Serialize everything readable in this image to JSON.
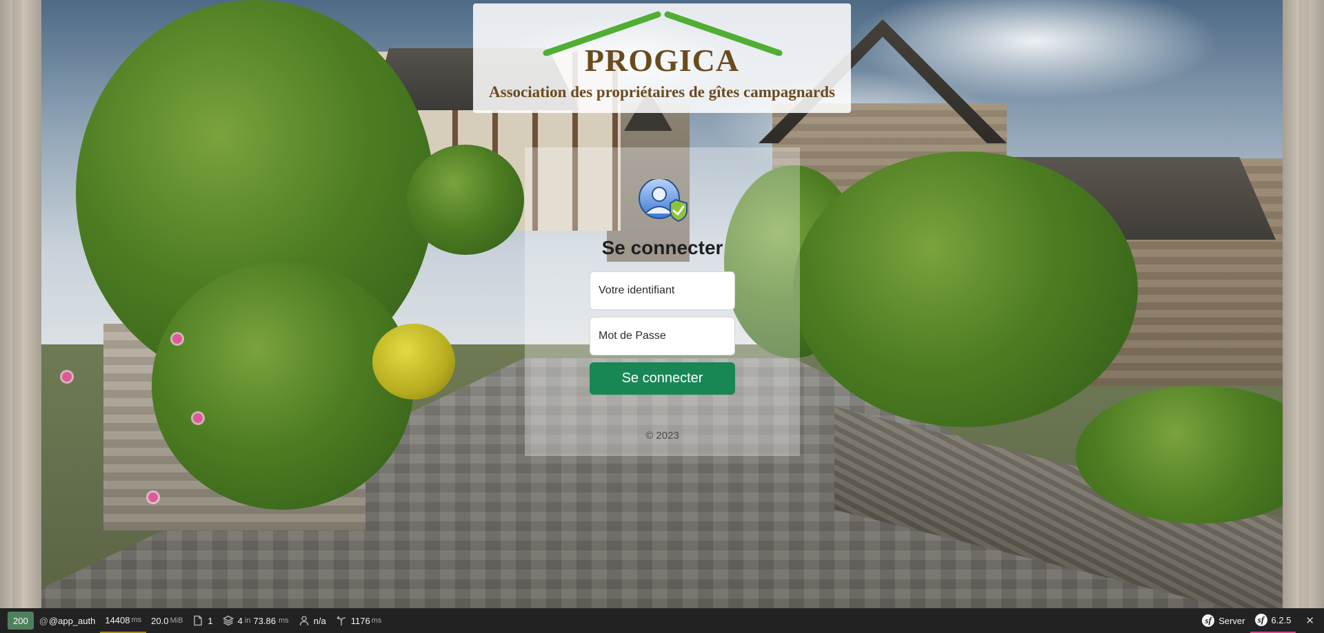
{
  "brand": {
    "name": "PROGICA",
    "tagline": "Association des propriétaires de gîtes campagnards"
  },
  "login": {
    "title": "Se connecter",
    "username_placeholder": "Votre identifiant",
    "password_placeholder": "Mot de Passe",
    "submit_label": "Se connecter",
    "copyright": "© 2023"
  },
  "debug_toolbar": {
    "status_code": "200",
    "route": "@app_auth",
    "request_time_value": "14408",
    "request_time_unit": "ms",
    "memory_value": "20.0",
    "memory_unit": "MiB",
    "forms_count": "1",
    "templates_count": "4",
    "templates_in": "in",
    "templates_time": "73.86",
    "templates_time_unit": "ms",
    "user": "n/a",
    "http_client_time": "1176",
    "http_client_unit": "ms",
    "server_label": "Server",
    "symfony_version": "6.2.5",
    "colors": {
      "status_ok": "#4f805d",
      "accent_button": "#198754",
      "brand_text": "#6b4a1f",
      "roof_green": "#4fae33"
    }
  }
}
